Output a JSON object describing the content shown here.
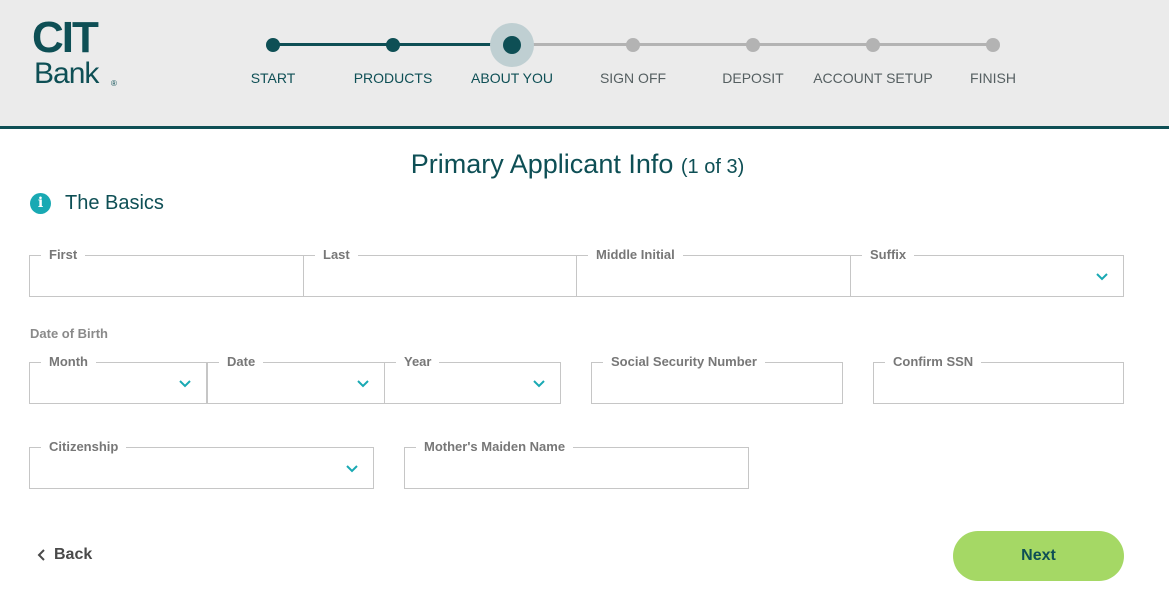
{
  "brand": {
    "name_top": "CIT",
    "name_bottom": "Bank",
    "registered_mark": "®"
  },
  "stepper": {
    "steps": [
      {
        "label": "START",
        "state": "done"
      },
      {
        "label": "PRODUCTS",
        "state": "done"
      },
      {
        "label": "ABOUT YOU",
        "state": "current"
      },
      {
        "label": "SIGN OFF",
        "state": "todo"
      },
      {
        "label": "DEPOSIT",
        "state": "todo"
      },
      {
        "label": "ACCOUNT SETUP",
        "state": "todo"
      },
      {
        "label": "FINISH",
        "state": "todo"
      }
    ]
  },
  "page": {
    "title": "Primary Applicant Info",
    "subtitle": "(1 of 3)"
  },
  "section": {
    "title": "The Basics",
    "icon": "info-icon"
  },
  "form": {
    "first": {
      "label": "First",
      "value": ""
    },
    "last": {
      "label": "Last",
      "value": ""
    },
    "middle_initial": {
      "label": "Middle Initial",
      "value": ""
    },
    "suffix": {
      "label": "Suffix",
      "value": "",
      "icon": "chevron-down-icon"
    },
    "dob_label": "Date of Birth",
    "month": {
      "label": "Month",
      "value": "",
      "icon": "chevron-down-icon"
    },
    "date": {
      "label": "Date",
      "value": "",
      "icon": "chevron-down-icon"
    },
    "year": {
      "label": "Year",
      "value": "",
      "icon": "chevron-down-icon"
    },
    "ssn": {
      "label": "Social Security Number",
      "value": ""
    },
    "confirm_ssn": {
      "label": "Confirm SSN",
      "value": ""
    },
    "citizenship": {
      "label": "Citizenship",
      "value": "",
      "icon": "chevron-down-icon"
    },
    "maiden_name": {
      "label": "Mother's Maiden Name",
      "value": ""
    }
  },
  "actions": {
    "back_label": "Back",
    "next_label": "Next"
  },
  "colors": {
    "brand_teal": "#0e4f55",
    "accent_cyan": "#19a9b3",
    "next_green": "#a5d865",
    "inactive_grey": "#b3b3b3",
    "header_bg": "#ebebeb"
  }
}
